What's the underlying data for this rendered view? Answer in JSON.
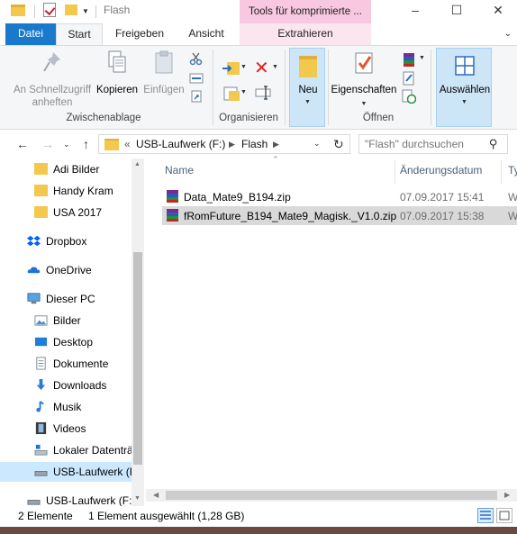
{
  "window": {
    "title": "Flash",
    "contextual_tab": "Tools für komprimierte ..."
  },
  "ribbon_tabs": {
    "file": "Datei",
    "home": "Start",
    "share": "Freigeben",
    "view": "Ansicht",
    "extract": "Extrahieren"
  },
  "ribbon": {
    "pin": "An Schnellzugriff anheften",
    "copy": "Kopieren",
    "paste": "Einfügen",
    "group_clipboard": "Zwischenablage",
    "group_organize": "Organisieren",
    "new": "Neu",
    "properties": "Eigenschaften",
    "group_open": "Öffnen",
    "select": "Auswählen"
  },
  "address": {
    "chevron": "«",
    "crumbs": [
      "USB-Laufwerk (F:)",
      "Flash"
    ],
    "search_placeholder": "\"Flash\" durchsuchen"
  },
  "nav": {
    "items": [
      {
        "label": "Adi Bilder",
        "icon": "folder-icon"
      },
      {
        "label": "Handy Kram",
        "icon": "folder-icon"
      },
      {
        "label": "USA 2017",
        "icon": "folder-icon"
      },
      {
        "label": "Dropbox",
        "icon": "dropbox-icon"
      },
      {
        "label": "OneDrive",
        "icon": "onedrive-icon"
      },
      {
        "label": "Dieser PC",
        "icon": "computer-icon"
      },
      {
        "label": "Bilder",
        "icon": "pictures-icon"
      },
      {
        "label": "Desktop",
        "icon": "desktop-icon"
      },
      {
        "label": "Dokumente",
        "icon": "documents-icon"
      },
      {
        "label": "Downloads",
        "icon": "downloads-icon"
      },
      {
        "label": "Musik",
        "icon": "music-icon"
      },
      {
        "label": "Videos",
        "icon": "videos-icon"
      },
      {
        "label": "Lokaler Datenträ",
        "icon": "local-disk-icon"
      },
      {
        "label": "USB-Laufwerk (F",
        "icon": "usb-drive-icon"
      },
      {
        "label": "USB-Laufwerk (F:)",
        "icon": "usb-drive-icon"
      }
    ]
  },
  "columns": {
    "name": "Name",
    "date": "Änderungsdatum",
    "type": "Ty"
  },
  "files": [
    {
      "name": "Data_Mate9_B194.zip",
      "date": "07.09.2017 15:41",
      "type": "W"
    },
    {
      "name": "fRomFuture_B194_Mate9_Magisk._V1.0.zip",
      "date": "07.09.2017 15:38",
      "type": "W"
    }
  ],
  "status": {
    "count": "2 Elemente",
    "selection": "1 Element ausgewählt (1,28 GB)"
  },
  "colors": {
    "file_tab": "#1979ca",
    "contextual": "#f7c8df",
    "selection": "#cce8ff"
  }
}
